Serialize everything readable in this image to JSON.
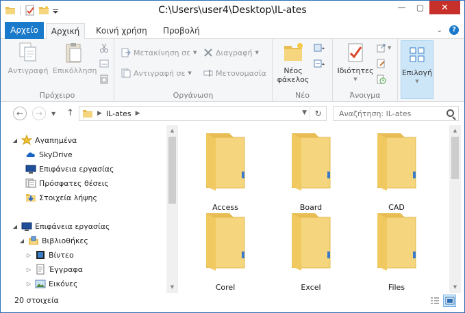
{
  "window": {
    "title": "C:\\Users\\user4\\Desktop\\IL-ates",
    "minimize": "—",
    "maximize": "▢",
    "close": "✕"
  },
  "tabs": [
    "Αρχείο",
    "Αρχική",
    "Κοινή χρήση",
    "Προβολή"
  ],
  "ribbon": {
    "clipboard": {
      "label": "Πρόχειρο",
      "copy": "Αντιγραφή",
      "paste": "Επικόλληση"
    },
    "organize": {
      "label": "Οργάνωση",
      "move_to": "Μετακίνηση σε",
      "copy_to": "Αντιγραφή σε",
      "delete": "Διαγραφή",
      "rename": "Μετονομασία"
    },
    "new": {
      "label": "Νέο",
      "new_folder_line1": "Νέος",
      "new_folder_line2": "φάκελος"
    },
    "open": {
      "label": "Άνοιγμα",
      "properties": "Ιδιότητες"
    },
    "select": {
      "label": "Επιλογή"
    }
  },
  "address": {
    "crumb": "IL-ates",
    "search_placeholder": "Αναζήτηση: IL-ates"
  },
  "nav": {
    "favorites": "Αγαπημένα",
    "skydrive": "SkyDrive",
    "desktop": "Επιφάνεια εργασίας",
    "recent": "Πρόσφατες θέσεις",
    "downloads": "Στοιχεία λήψης",
    "desktop_root": "Επιφάνεια εργασίας",
    "libraries": "Βιβλιοθήκες",
    "videos": "Βίντεο",
    "documents": "Έγγραφα",
    "pictures": "Εικόνες"
  },
  "folders": [
    "Access",
    "Board",
    "CAD",
    "Corel",
    "Excel",
    "Files"
  ],
  "status": {
    "count": "20 στοιχεία"
  },
  "colors": {
    "file_tab": "#1979ca",
    "close_button": "#c7302a",
    "folder_body": "#f5d57e",
    "folder_back": "#e8bd54",
    "select_highlight": "#cde6f7"
  }
}
